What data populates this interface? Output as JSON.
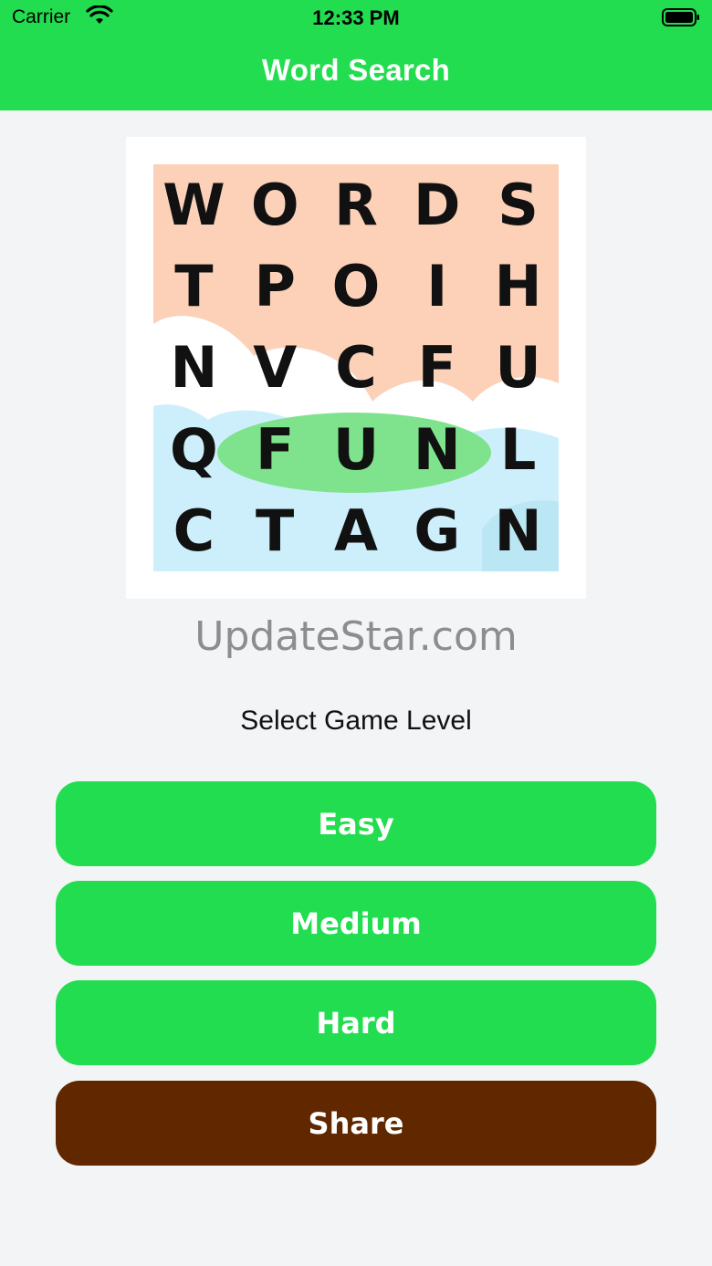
{
  "status_bar": {
    "carrier": "Carrier",
    "time": "12:33 PM"
  },
  "header": {
    "title": "Word Search",
    "color": "#22dd4f"
  },
  "hero": {
    "rows": [
      [
        "W",
        "O",
        "R",
        "D",
        "S"
      ],
      [
        "T",
        "P",
        "O",
        "I",
        "H"
      ],
      [
        "N",
        "V",
        "C",
        "F",
        "U"
      ],
      [
        "Q",
        "F",
        "U",
        "N",
        "L"
      ],
      [
        "C",
        "T",
        "A",
        "G",
        "N"
      ]
    ],
    "highlighted_word": "FUN",
    "highlight_color": "#7ee38c"
  },
  "watermark": "UpdateStar.com",
  "level_prompt": "Select Game Level",
  "buttons": {
    "easy": "Easy",
    "medium": "Medium",
    "hard": "Hard",
    "share": "Share"
  },
  "colors": {
    "button_green": "#22dd4f",
    "share_brown": "#612800",
    "background": "#f3f4f5"
  }
}
